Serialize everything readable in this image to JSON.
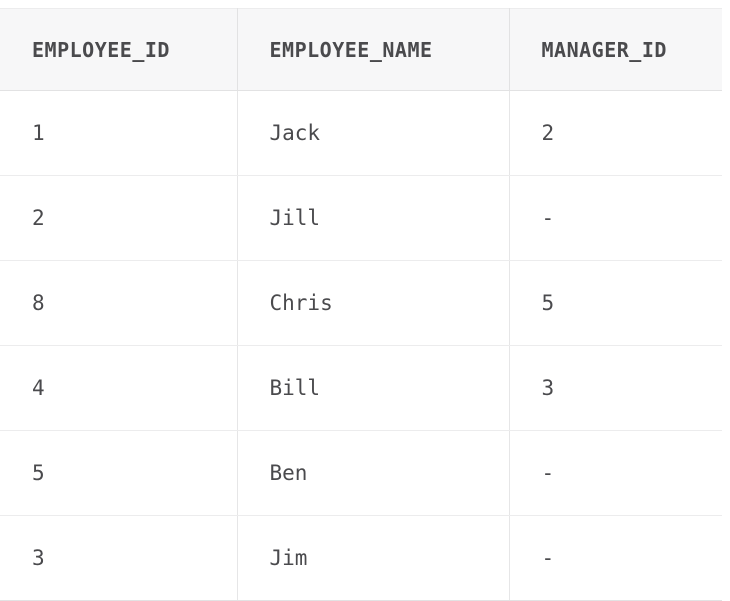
{
  "table": {
    "columns": [
      "EMPLOYEE_ID",
      "EMPLOYEE_NAME",
      "MANAGER_ID"
    ],
    "rows": [
      [
        "1",
        "Jack",
        "2"
      ],
      [
        "2",
        "Jill",
        "-"
      ],
      [
        "8",
        "Chris",
        "5"
      ],
      [
        "4",
        "Bill",
        "3"
      ],
      [
        "5",
        "Ben",
        "-"
      ],
      [
        "3",
        "Jim",
        "-"
      ]
    ]
  },
  "chart_data": {
    "type": "table",
    "title": "",
    "columns": [
      "EMPLOYEE_ID",
      "EMPLOYEE_NAME",
      "MANAGER_ID"
    ],
    "rows": [
      [
        "1",
        "Jack",
        "2"
      ],
      [
        "2",
        "Jill",
        "-"
      ],
      [
        "8",
        "Chris",
        "5"
      ],
      [
        "4",
        "Bill",
        "3"
      ],
      [
        "5",
        "Ben",
        "-"
      ],
      [
        "3",
        "Jim",
        "-"
      ]
    ]
  },
  "style": {
    "header_background": "#f7f7f8",
    "text_color": "#4a4a4d",
    "border_color": "#e2e2e3",
    "row_border_color": "#ececed",
    "body_background": "#ffffff"
  }
}
